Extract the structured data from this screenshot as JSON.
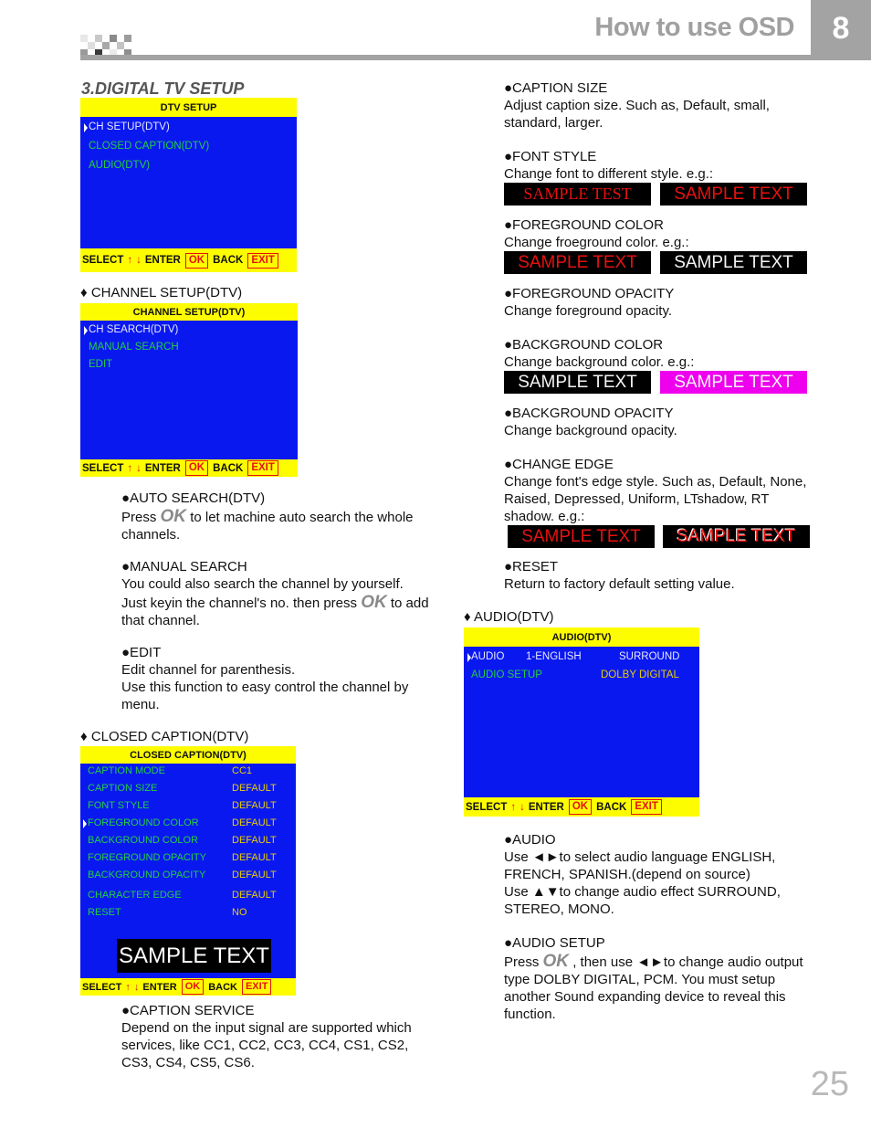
{
  "header": {
    "title": "How to use OSD",
    "chapter": "8"
  },
  "page_number": "25",
  "section_title": "3.DIGITAL TV SETUP",
  "osd_footer": {
    "select": "SELECT",
    "up_arrow": "↑",
    "down_arrow": "↓",
    "enter": "ENTER",
    "ok": "OK",
    "back": "BACK",
    "exit": "EXIT"
  },
  "dtv_setup_menu": {
    "title": "DTV SETUP",
    "items": [
      "CH SETUP(DTV)",
      "CLOSED CAPTION(DTV)",
      "AUDIO(DTV)"
    ],
    "selected_index": 0
  },
  "channel_setup": {
    "heading": "♦ CHANNEL SETUP(DTV)",
    "menu": {
      "title": "CHANNEL SETUP(DTV)",
      "items": [
        "CH SEARCH(DTV)",
        "MANUAL SEARCH",
        "EDIT"
      ],
      "selected_index": 0
    },
    "descriptions": {
      "auto_search": {
        "title": "●AUTO SEARCH(DTV)",
        "pre": "Press",
        "ok": "OK",
        "post": "to let machine auto search the whole channels."
      },
      "manual_search": {
        "title": "●MANUAL SEARCH",
        "line1": "You could also search the channel by yourself.",
        "pre": "Just keyin the channel's no. then press",
        "ok": "OK",
        "post": "to add that channel."
      },
      "edit": {
        "title": "●EDIT",
        "line1": "Edit channel for parenthesis.",
        "line2": "Use this function to easy control the channel by menu."
      }
    }
  },
  "closed_caption": {
    "heading": "♦ CLOSED CAPTION(DTV)",
    "menu": {
      "title": "CLOSED CAPTION(DTV)",
      "rows": [
        {
          "label": "CAPTION MODE",
          "value": "CC1"
        },
        {
          "label": "CAPTION SIZE",
          "value": "DEFAULT"
        },
        {
          "label": "FONT STYLE",
          "value": "DEFAULT"
        },
        {
          "label": "FOREGROUND COLOR",
          "value": "DEFAULT"
        },
        {
          "label": "BACKGROUND COLOR",
          "value": "DEFAULT"
        },
        {
          "label": "FOREGROUND OPACITY",
          "value": "DEFAULT"
        },
        {
          "label": "BACKGROUND OPACITY",
          "value": "DEFAULT"
        },
        {
          "label": "CHARACTER EDGE",
          "value": "DEFAULT"
        },
        {
          "label": "RESET",
          "value": "NO"
        }
      ],
      "selected_index": 3,
      "preview_text": "SAMPLE TEXT"
    },
    "caption_service": {
      "title": "●CAPTION SERVICE",
      "body": "Depend on the input  signal are  supported which services, like CC1, CC2, CC3, CC4, CS1, CS2, CS3, CS4, CS5, CS6."
    },
    "caption_size": {
      "title": "●CAPTION SIZE",
      "body": "Adjust caption size. Such as, Default, small, standard, larger."
    },
    "font_style": {
      "title": "●FONT STYLE",
      "body": "Change font to different style. e.g.:",
      "samples": [
        "SAMPLE TEST",
        "SAMPLE TEXT"
      ]
    },
    "foreground_color": {
      "title": "●FOREGROUND COLOR",
      "body": "Change froeground color. e.g.:",
      "samples": [
        "SAMPLE TEXT",
        "SAMPLE TEXT"
      ]
    },
    "foreground_opacity": {
      "title": "●FOREGROUND OPACITY",
      "body": "Change foreground opacity."
    },
    "background_color": {
      "title": "●BACKGROUND COLOR",
      "body": "Change background color. e.g.:",
      "samples": [
        "SAMPLE TEXT",
        "SAMPLE TEXT"
      ]
    },
    "background_opacity": {
      "title": "●BACKGROUND OPACITY",
      "body": "Change background opacity."
    },
    "change_edge": {
      "title": "●CHANGE EDGE",
      "body": "Change font's edge style. Such as, Default, None, Raised, Depressed, Uniform, LTshadow, RT shadow.  e.g.:",
      "samples": [
        "SAMPLE TEXT",
        "SAMPLE TEXT"
      ]
    },
    "reset": {
      "title": "●RESET",
      "body": "Return to factory default setting value."
    }
  },
  "audio": {
    "heading": "♦ AUDIO(DTV)",
    "menu": {
      "title": "AUDIO(DTV)",
      "rows": [
        {
          "label": "AUDIO",
          "value1": "1-ENGLISH",
          "value2": "SURROUND"
        },
        {
          "label": "AUDIO SETUP",
          "value2": "DOLBY DIGITAL"
        }
      ],
      "selected_index": 0
    },
    "audio_desc": {
      "title": "●AUDIO",
      "line1": "Use ◄►to select audio language ENGLISH, FRENCH, SPANISH.(depend on source)",
      "line2": "Use ▲▼to change audio effect SURROUND, STEREO, MONO."
    },
    "audio_setup_desc": {
      "title": "●AUDIO SETUP",
      "pre": "Press",
      "ok": "OK",
      "post": ", then use ◄►to change audio output type DOLBY DIGITAL, PCM. You must setup another Sound expanding device to reveal this function."
    }
  },
  "colors": {
    "osd_blue": "#0a18f0",
    "osd_yellow": "#fdfd00",
    "osd_green": "#22d040",
    "sample_red": "#e81010",
    "sample_magenta": "#ee00ee",
    "header_gray": "#a3a3a3"
  }
}
